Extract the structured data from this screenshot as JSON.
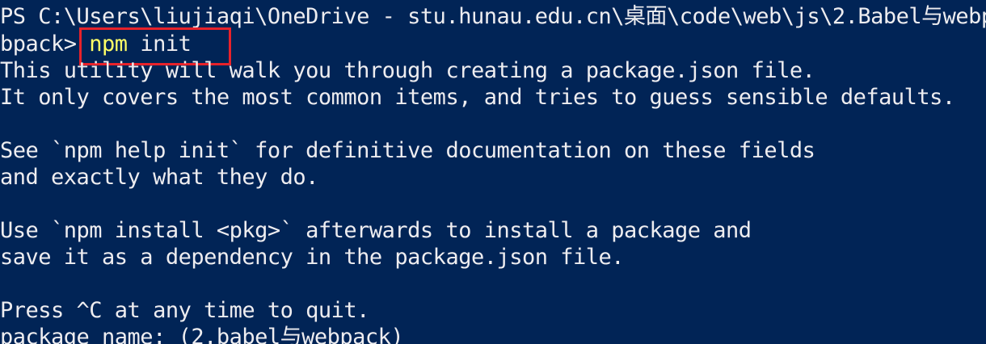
{
  "terminal": {
    "background": "#012456",
    "foreground": "#eeedf0",
    "command_color": "#ffff66",
    "highlight_color": "#e8222a",
    "prompt_path_line1": "PS C:\\Users\\liujiaqi\\OneDrive - stu.hunau.edu.cn\\桌面\\code\\web\\js\\2.Babel与webpack",
    "prompt_path_line2": "bpack> ",
    "command_name": "npm",
    "command_args": " init",
    "output_lines": [
      "This utility will walk you through creating a package.json file.",
      "It only covers the most common items, and tries to guess sensible defaults.",
      "See `npm help init` for definitive documentation on these fields",
      "and exactly what they do.",
      "Use `npm install <pkg>` afterwards to install a package and",
      "save it as a dependency in the package.json file.",
      "Press ^C at any time to quit.",
      "package name: (2.babel与webpack)"
    ]
  }
}
